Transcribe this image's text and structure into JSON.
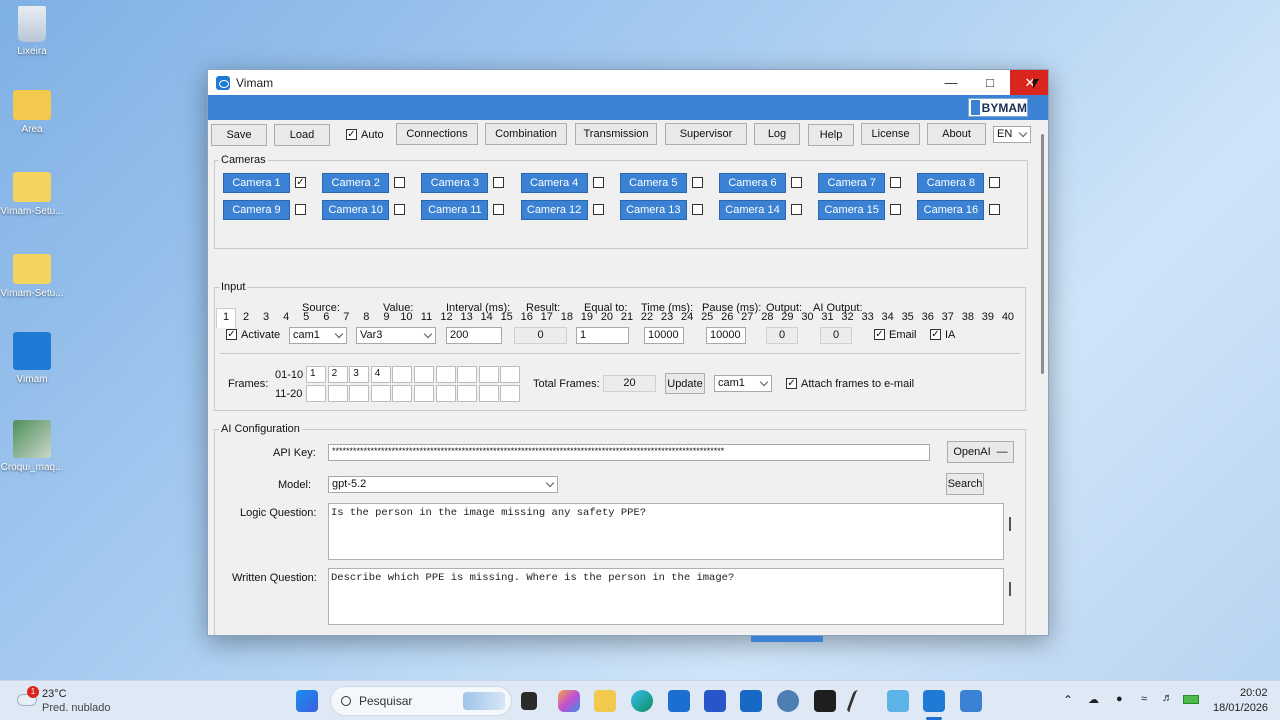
{
  "desktop": {
    "icons": [
      {
        "label": "Lixeira"
      },
      {
        "label": "Area"
      },
      {
        "label": "Vimam-Setu..."
      },
      {
        "label": "Vimam-Setu..."
      },
      {
        "label": "Vimam"
      },
      {
        "label": "Croqui_maq..."
      }
    ]
  },
  "window": {
    "title": "Vimam",
    "brand": "BYMAM",
    "toolbar": {
      "save": "Save",
      "load": "Load",
      "auto_label": "Auto",
      "connections": "Connections",
      "combination": "Combination",
      "transmission": "Transmission",
      "supervisor": "Supervisor",
      "log": "Log",
      "help": "Help",
      "license": "License",
      "about": "About",
      "language": "EN"
    },
    "cameras": {
      "title": "Cameras",
      "items": [
        "Camera 1",
        "Camera 2",
        "Camera 3",
        "Camera 4",
        "Camera 5",
        "Camera 6",
        "Camera 7",
        "Camera 8",
        "Camera 9",
        "Camera 10",
        "Camera 11",
        "Camera 12",
        "Camera 13",
        "Camera 14",
        "Camera 15",
        "Camera 16"
      ],
      "checked": [
        true,
        false,
        false,
        false,
        false,
        false,
        false,
        false,
        false,
        false,
        false,
        false,
        false,
        false,
        false,
        false
      ]
    },
    "tabs": [
      "1",
      "2",
      "3",
      "4",
      "5",
      "6",
      "7",
      "8",
      "9",
      "10",
      "11",
      "12",
      "13",
      "14",
      "15",
      "16",
      "17",
      "18",
      "19",
      "20",
      "21",
      "22",
      "23",
      "24",
      "25",
      "26",
      "27",
      "28",
      "29",
      "30",
      "31",
      "32",
      "33",
      "34",
      "35",
      "36",
      "37",
      "38",
      "39",
      "40"
    ],
    "input": {
      "title": "Input",
      "headers": {
        "source": "Source:",
        "value": "Value:",
        "interval": "Interval (ms):",
        "result": "Result:",
        "equal_to": "Equal to:",
        "time": "Time (ms):",
        "pause": "Pause (ms):",
        "output": "Output:",
        "ai_output": "AI Output:"
      },
      "activate_label": "Activate",
      "source_value": "cam1",
      "value_value": "Var3",
      "interval_value": "200",
      "result_value": "0",
      "equal_to_value": "1",
      "time_value": "10000",
      "pause_value": "10000",
      "output_value": "0",
      "ai_output_value": "0",
      "email_label": "Email",
      "ia_label": "IA",
      "frames_label": "Frames:",
      "row1_label": "01-10",
      "row2_label": "11-20",
      "row1_values": [
        "1",
        "2",
        "3",
        "4",
        "",
        "",
        "",
        "",
        "",
        ""
      ],
      "row2_values": [
        "",
        "",
        "",
        "",
        "",
        "",
        "",
        "",
        "",
        ""
      ],
      "total_frames_label": "Total Frames:",
      "total_frames_value": "20",
      "update_label": "Update",
      "frames_source": "cam1",
      "attach_label": "Attach frames to e-mail"
    },
    "ai": {
      "title": "AI Configuration",
      "api_key_label": "API Key:",
      "api_key_value": "****************************************************************************************************************",
      "provider": "OpenAI",
      "model_label": "Model:",
      "model_value": "gpt-5.2",
      "search_label": "Search",
      "logic_label": "Logic Question:",
      "logic_value": "Is the person in the image missing any safety PPE?",
      "written_label": "Written Question:",
      "written_value": "Describe which PPE is missing. Where is the person in the image?"
    }
  },
  "taskbar": {
    "weather_temp": "23°C",
    "weather_desc": "Pred. nublado",
    "weather_badge": "1",
    "search_placeholder": "Pesquisar",
    "time": "20:02",
    "date": "18/01/2026"
  }
}
